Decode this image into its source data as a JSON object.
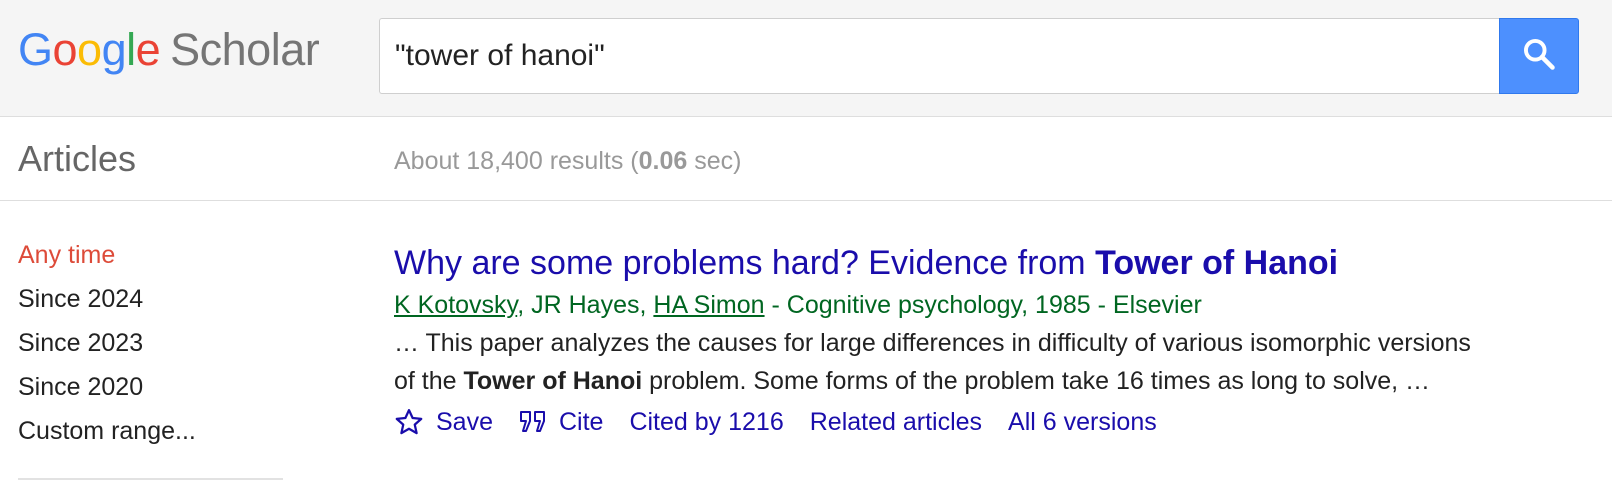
{
  "header": {
    "logo": {
      "google_letters": [
        {
          "char": "G",
          "color": "#4285f4"
        },
        {
          "char": "o",
          "color": "#ea4335"
        },
        {
          "char": "o",
          "color": "#fbbc05"
        },
        {
          "char": "g",
          "color": "#4285f4"
        },
        {
          "char": "l",
          "color": "#34a853"
        },
        {
          "char": "e",
          "color": "#ea4335"
        }
      ],
      "product": "Scholar"
    },
    "search": {
      "value": "\"tower of hanoi\"",
      "button_icon": "search-icon",
      "button_color": "#4d90fe"
    }
  },
  "subbar": {
    "section_title": "Articles",
    "stats_prefix": "About 18,400 results (",
    "stats_time": "0.06",
    "stats_suffix": " sec)"
  },
  "sidebar": {
    "items": [
      {
        "label": "Any time",
        "active": true
      },
      {
        "label": "Since 2024",
        "active": false
      },
      {
        "label": "Since 2023",
        "active": false
      },
      {
        "label": "Since 2020",
        "active": false
      },
      {
        "label": "Custom range...",
        "active": false
      }
    ],
    "active_color": "#dd4b39"
  },
  "results": [
    {
      "title_plain": "Why are some problems hard? Evidence from ",
      "title_bold": "Tower of Hanoi",
      "authors": [
        {
          "name": "K Kotovsky",
          "linked": true
        },
        {
          "name": "JR Hayes",
          "linked": false
        },
        {
          "name": "HA Simon",
          "linked": true
        }
      ],
      "source": " - Cognitive psychology, 1985 - Elsevier",
      "snippet_line1": "… This paper analyzes the causes for large differences in difficulty of various isomorphic versions",
      "snippet_line2_pre": "of the ",
      "snippet_line2_bold": "Tower of Hanoi",
      "snippet_line2_post": " problem. Some forms of the problem take 16 times as long to solve, …",
      "actions": {
        "save_label": "Save",
        "save_icon": "star-icon",
        "cite_label": "Cite",
        "cite_icon": "quote-icon",
        "cited_by": "Cited by 1216",
        "related": "Related articles",
        "versions": "All 6 versions"
      }
    }
  ],
  "colors": {
    "link": "#1a0dab",
    "author_green": "#006621",
    "muted": "#999999",
    "header_bg": "#f5f5f5"
  }
}
